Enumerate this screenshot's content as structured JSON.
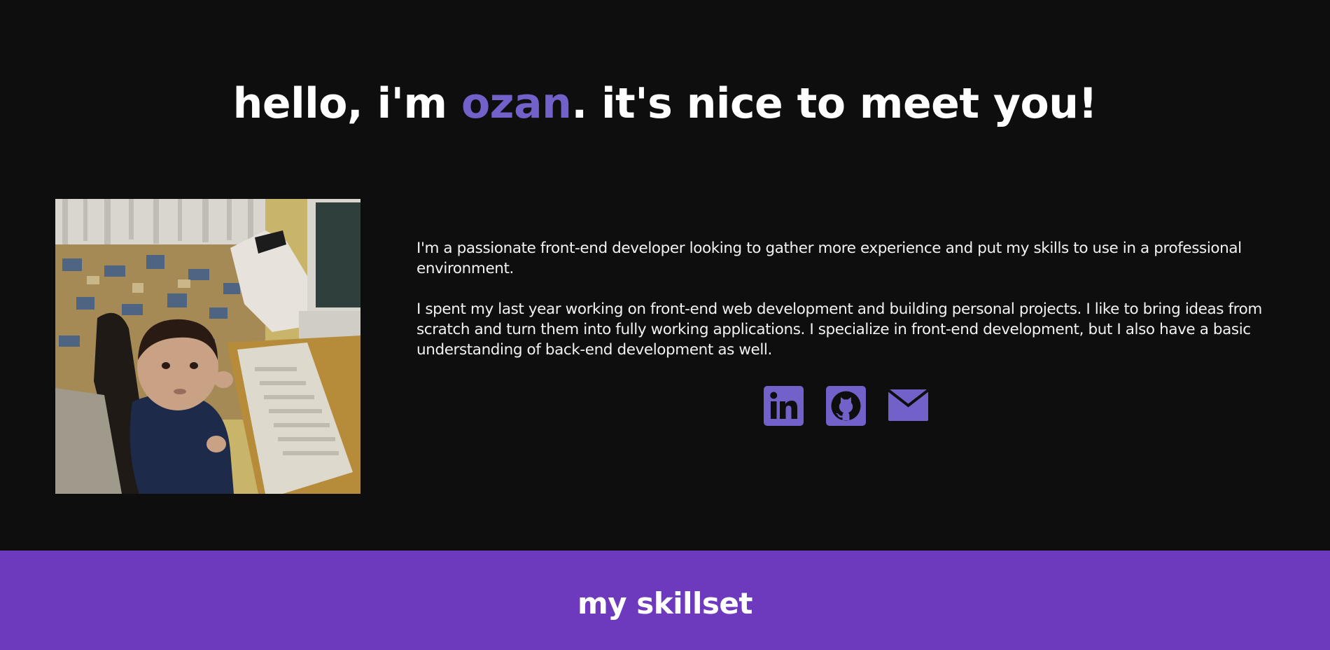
{
  "hero": {
    "greeting": "hello, i'm ",
    "name": "ozan",
    "rest": ". it's nice to meet you!"
  },
  "about": {
    "photo_alt": "Baby sitting at a desk next to a computer keyboard",
    "paragraph_1": "I'm a passionate front-end developer looking to gather more experience and put my skills to use in a professional environment.",
    "paragraph_2": "I spent my last year working on front-end web development and building personal projects. I like to bring ideas from scratch and turn them into fully working applications. I specialize in front-end development, but I also have a basic understanding of back-end development as well."
  },
  "socials": [
    {
      "icon": "linkedin-icon"
    },
    {
      "icon": "github-icon"
    },
    {
      "icon": "mail-icon"
    }
  ],
  "skillset": {
    "title": "my skillset"
  },
  "colors": {
    "background": "#0e0e0e",
    "accent": "#7261c9",
    "skillset_band": "#6d3abd",
    "text": "#ffffff"
  }
}
